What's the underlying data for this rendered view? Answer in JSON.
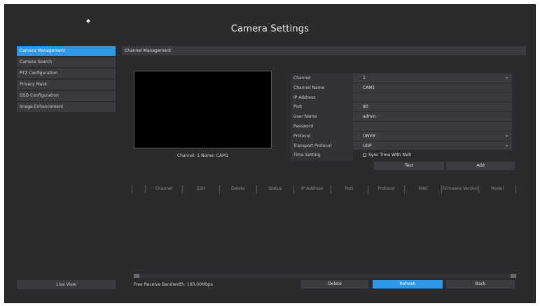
{
  "window": {
    "title": "Camera Settings"
  },
  "sidebar": {
    "items": [
      {
        "label": "Camera Management",
        "active": true
      },
      {
        "label": "Camera Search",
        "active": false
      },
      {
        "label": "PTZ Configuration",
        "active": false
      },
      {
        "label": "Privacy Mask",
        "active": false
      },
      {
        "label": "OSD Configuration",
        "active": false
      },
      {
        "label": "Image Enhancement",
        "active": false
      }
    ],
    "live_view_label": "Live View"
  },
  "section": {
    "title": "Channel Management"
  },
  "preview": {
    "caption": "Channel: 1 Name: CAM1"
  },
  "form": {
    "channel": {
      "label": "Channel",
      "value": "1"
    },
    "channel_name": {
      "label": "Channel Name",
      "value": "CAM1"
    },
    "ip_address": {
      "label": "IP Address",
      "value": ""
    },
    "port": {
      "label": "Port",
      "value": "80"
    },
    "user_name": {
      "label": "User Name",
      "value": "admin"
    },
    "password": {
      "label": "Password",
      "value": ""
    },
    "protocol": {
      "label": "Protocol",
      "value": "ONVIF"
    },
    "transport_protocol": {
      "label": "Transport Protocol",
      "value": "UDP"
    },
    "time_setting": {
      "label": "Time Setting",
      "checkbox_label": "Sync Time With NVR",
      "checked": false
    }
  },
  "buttons": {
    "test": "Test",
    "add": "Add",
    "delete": "Delete",
    "refresh": "Refresh",
    "back": "Back"
  },
  "table": {
    "columns": [
      "",
      "Channel",
      "Edit",
      "Delete",
      "Status",
      "IP Address",
      "Port",
      "Protocol",
      "MAC",
      "Firmware Version",
      "Model"
    ]
  },
  "footer": {
    "bandwidth": "Free Receive Bandwidth: 160.00Mbps"
  },
  "colors": {
    "accent": "#2e98e6",
    "panel": "#2a2b2d",
    "field": "#3a3b3e"
  }
}
